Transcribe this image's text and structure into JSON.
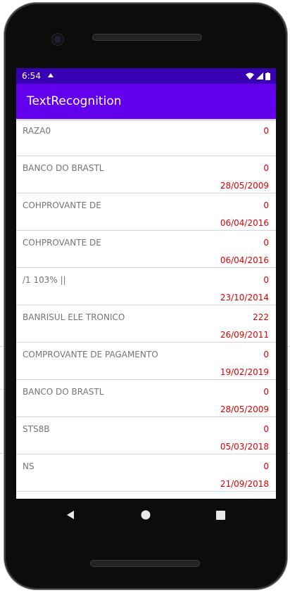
{
  "status_bar": {
    "time": "6:54"
  },
  "app": {
    "title": "TextRecognition"
  },
  "items": [
    {
      "title": "RAZA0",
      "count": "0",
      "date": ""
    },
    {
      "title": "BANCO DO BRASTL",
      "count": "0",
      "date": "28/05/2009"
    },
    {
      "title": "COHPROVANTE DE",
      "count": "0",
      "date": "06/04/2016"
    },
    {
      "title": "COHPROVANTE DE",
      "count": "0",
      "date": "06/04/2016"
    },
    {
      "title": "/1 103% ||",
      "count": "0",
      "date": "23/10/2014"
    },
    {
      "title": "BANRISUL ELE TRONICO",
      "count": "222",
      "date": "26/09/2011"
    },
    {
      "title": "COMPROVANTE DE PAGAMENTO",
      "count": "0",
      "date": "19/02/2019"
    },
    {
      "title": "BANCO DO BRASTL",
      "count": "0",
      "date": "28/05/2009"
    },
    {
      "title": "STS8B",
      "count": "0",
      "date": "05/03/2018"
    },
    {
      "title": "NS",
      "count": "0",
      "date": "21/09/2018"
    }
  ],
  "colors": {
    "status_bar": "#3700b3",
    "app_bar": "#6200ee",
    "value_red": "#e00000",
    "title_gray": "#757575"
  },
  "icons": {
    "status": [
      "notification-icon",
      "wifi-icon",
      "signal-icon",
      "battery-icon"
    ],
    "navigation": [
      "back-icon",
      "home-icon",
      "recents-icon"
    ]
  }
}
